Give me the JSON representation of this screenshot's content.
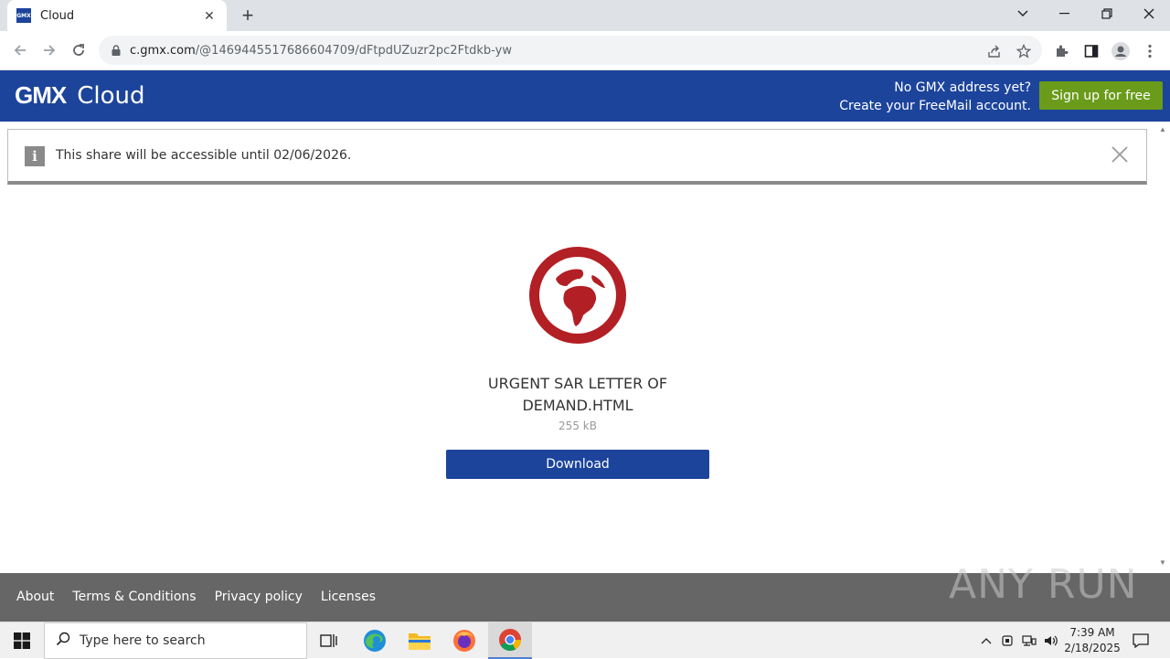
{
  "browser": {
    "tab_title": "Cloud",
    "tab_favicon_text": "GMX",
    "url_host": "c.gmx.com",
    "url_path": "/@1469445517686604709/dFtpdUZuzr2pc2Ftdkb-yw"
  },
  "header": {
    "brand": "GMX",
    "product": "Cloud",
    "promo_line1": "No GMX address yet?",
    "promo_line2": "Create your FreeMail account.",
    "signup_label": "Sign up for free",
    "colors": {
      "header_bg": "#1c449b",
      "signup_bg": "#6a9b1a"
    }
  },
  "notice": {
    "text": "This share will be accessible until 02/06/2026."
  },
  "file": {
    "icon": "globe-icon",
    "icon_color": "#b21f24",
    "name_line1": "URGENT SAR LETTER OF",
    "name_line2": "DEMAND.HTML",
    "size": "255 kB",
    "download_label": "Download"
  },
  "footer": {
    "links": [
      "About",
      "Terms & Conditions",
      "Privacy policy",
      "Licenses"
    ]
  },
  "watermark": "ANY RUN",
  "taskbar": {
    "search_placeholder": "Type here to search",
    "time": "7:39 AM",
    "date": "2/18/2025"
  }
}
